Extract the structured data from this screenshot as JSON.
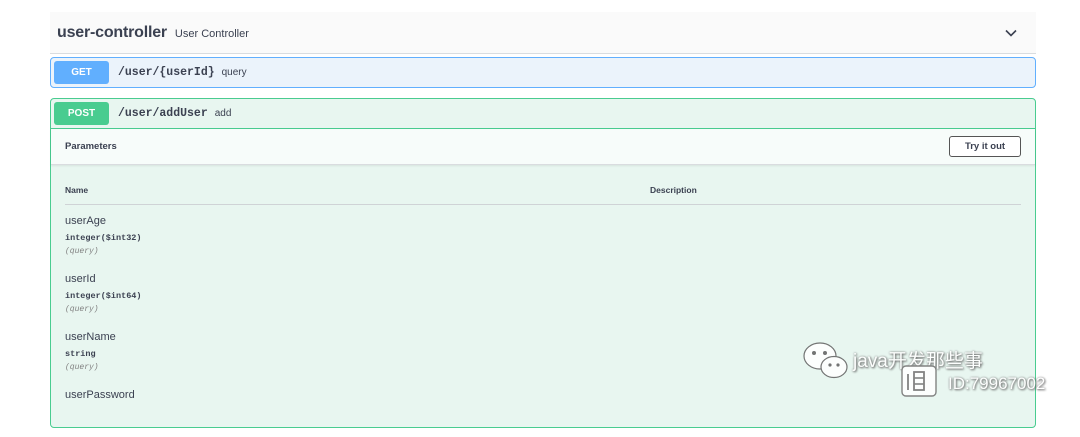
{
  "tag": {
    "title": "user-controller",
    "description": "User Controller",
    "expand_icon": "chevron-down-icon"
  },
  "operations": [
    {
      "method": "GET",
      "path": "/user/{userId}",
      "summary": "query",
      "color": "#61affe",
      "bg": "#ebf3fb"
    },
    {
      "method": "POST",
      "path": "/user/addUser",
      "summary": "add",
      "color": "#49cc90",
      "bg": "#e8f6f0"
    }
  ],
  "parameters": {
    "section_title": "Parameters",
    "try_button": "Try it out",
    "columns": [
      "Name",
      "Description"
    ],
    "rows": [
      {
        "name": "userAge",
        "type": "integer($int32)",
        "in": "(query)"
      },
      {
        "name": "userId",
        "type": "integer($int64)",
        "in": "(query)"
      },
      {
        "name": "userName",
        "type": "string",
        "in": "(query)"
      },
      {
        "name": "userPassword",
        "type": "",
        "in": ""
      }
    ]
  },
  "watermark": {
    "line1": "java开发那些事",
    "line2": "ID:79967002",
    "icon": "wechat-icon"
  }
}
